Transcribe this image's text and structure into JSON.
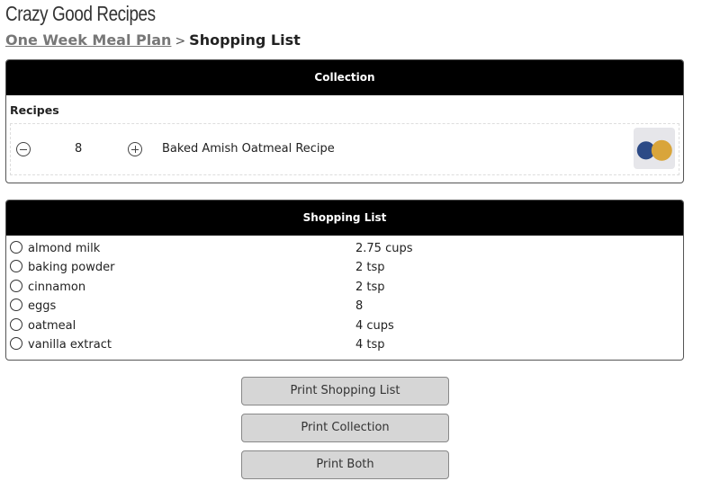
{
  "site": {
    "title": "Crazy Good Recipes"
  },
  "breadcrumb": {
    "parent": "One Week Meal Plan",
    "separator": ">",
    "current": "Shopping List"
  },
  "collection": {
    "header": "Collection",
    "recipes_label": "Recipes",
    "recipes": [
      {
        "quantity": "8",
        "name": "Baked Amish Oatmeal Recipe",
        "thumbnail": "oatmeal-with-blueberries-photo"
      }
    ]
  },
  "shopping_list": {
    "header": "Shopping List",
    "items": [
      {
        "name": "almond milk",
        "quantity": "2.75 cups",
        "checked": false
      },
      {
        "name": "baking powder",
        "quantity": "2 tsp",
        "checked": false
      },
      {
        "name": "cinnamon",
        "quantity": "2 tsp",
        "checked": false
      },
      {
        "name": "eggs",
        "quantity": "8",
        "checked": false
      },
      {
        "name": "oatmeal",
        "quantity": "4 cups",
        "checked": false
      },
      {
        "name": "vanilla extract",
        "quantity": "4 tsp",
        "checked": false
      }
    ]
  },
  "actions": {
    "print_shopping_list": "Print Shopping List",
    "print_collection": "Print Collection",
    "print_both": "Print Both"
  }
}
